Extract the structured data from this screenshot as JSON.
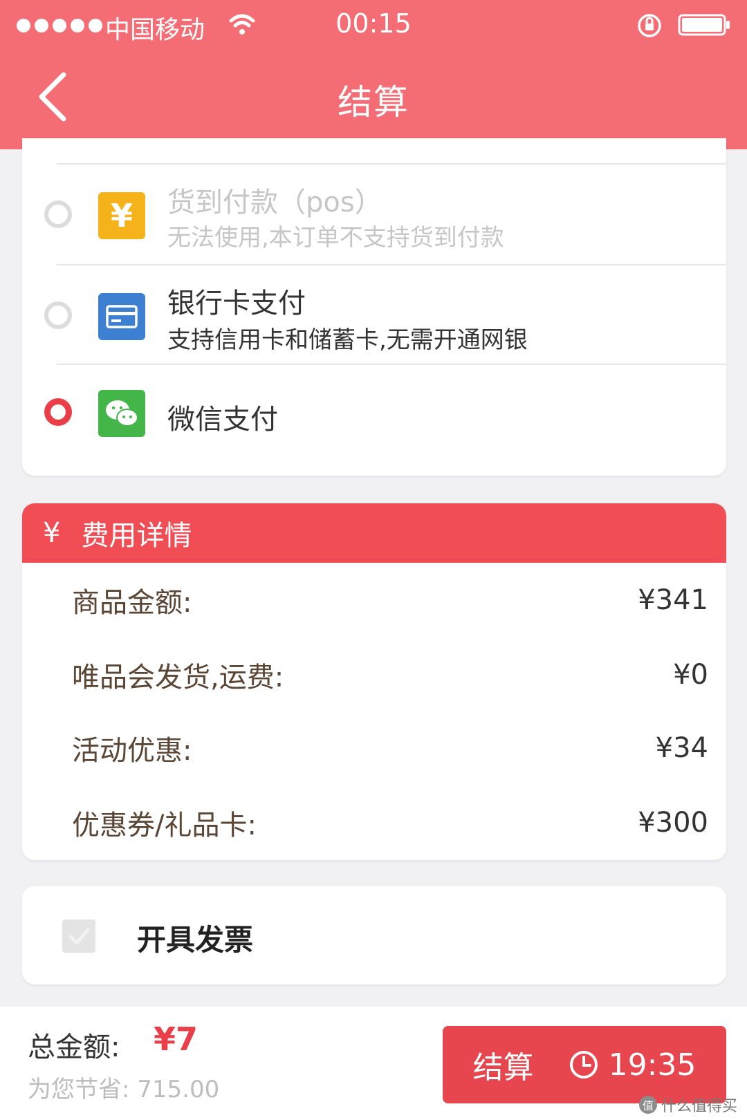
{
  "status_bar": {
    "carrier": "中国移动",
    "time": "00:15"
  },
  "nav": {
    "title": "结算"
  },
  "payment": {
    "options": [
      {
        "title": "货到付款（pos）",
        "subtitle": "无法使用,本订单不支持货到付款",
        "icon": "yen-icon",
        "icon_glyph": "¥",
        "icon_color": "#f6b21b",
        "enabled": false,
        "selected": false
      },
      {
        "title": "银行卡支付",
        "subtitle": "支持信用卡和储蓄卡,无需开通网银",
        "icon": "bank-card-icon",
        "icon_color": "#3d7fd0",
        "enabled": true,
        "selected": false
      },
      {
        "title": "微信支付",
        "subtitle": "",
        "icon": "wechat-icon",
        "icon_color": "#44b549",
        "enabled": true,
        "selected": true
      }
    ]
  },
  "fees": {
    "header_icon": "¥",
    "header": "费用详情",
    "rows": [
      {
        "label": "商品金额:",
        "value": "¥341"
      },
      {
        "label": "唯品会发货,运费:",
        "value": "¥0"
      },
      {
        "label": "活动优惠:",
        "value": "¥34"
      },
      {
        "label": "优惠券/礼品卡:",
        "value": "¥300"
      }
    ]
  },
  "invoice": {
    "label": "开具发票",
    "checked": false
  },
  "footer": {
    "total_label": "总金额:",
    "total_amount": "¥7",
    "saved": "为您节省: 715.00",
    "checkout_label": "结算",
    "countdown": "19:35"
  },
  "watermark": {
    "badge": "值",
    "text": "什么值得买"
  },
  "colors": {
    "header_bg": "#f46c74",
    "accent": "#ea3f48",
    "fee_header_bg": "#f04d55"
  }
}
